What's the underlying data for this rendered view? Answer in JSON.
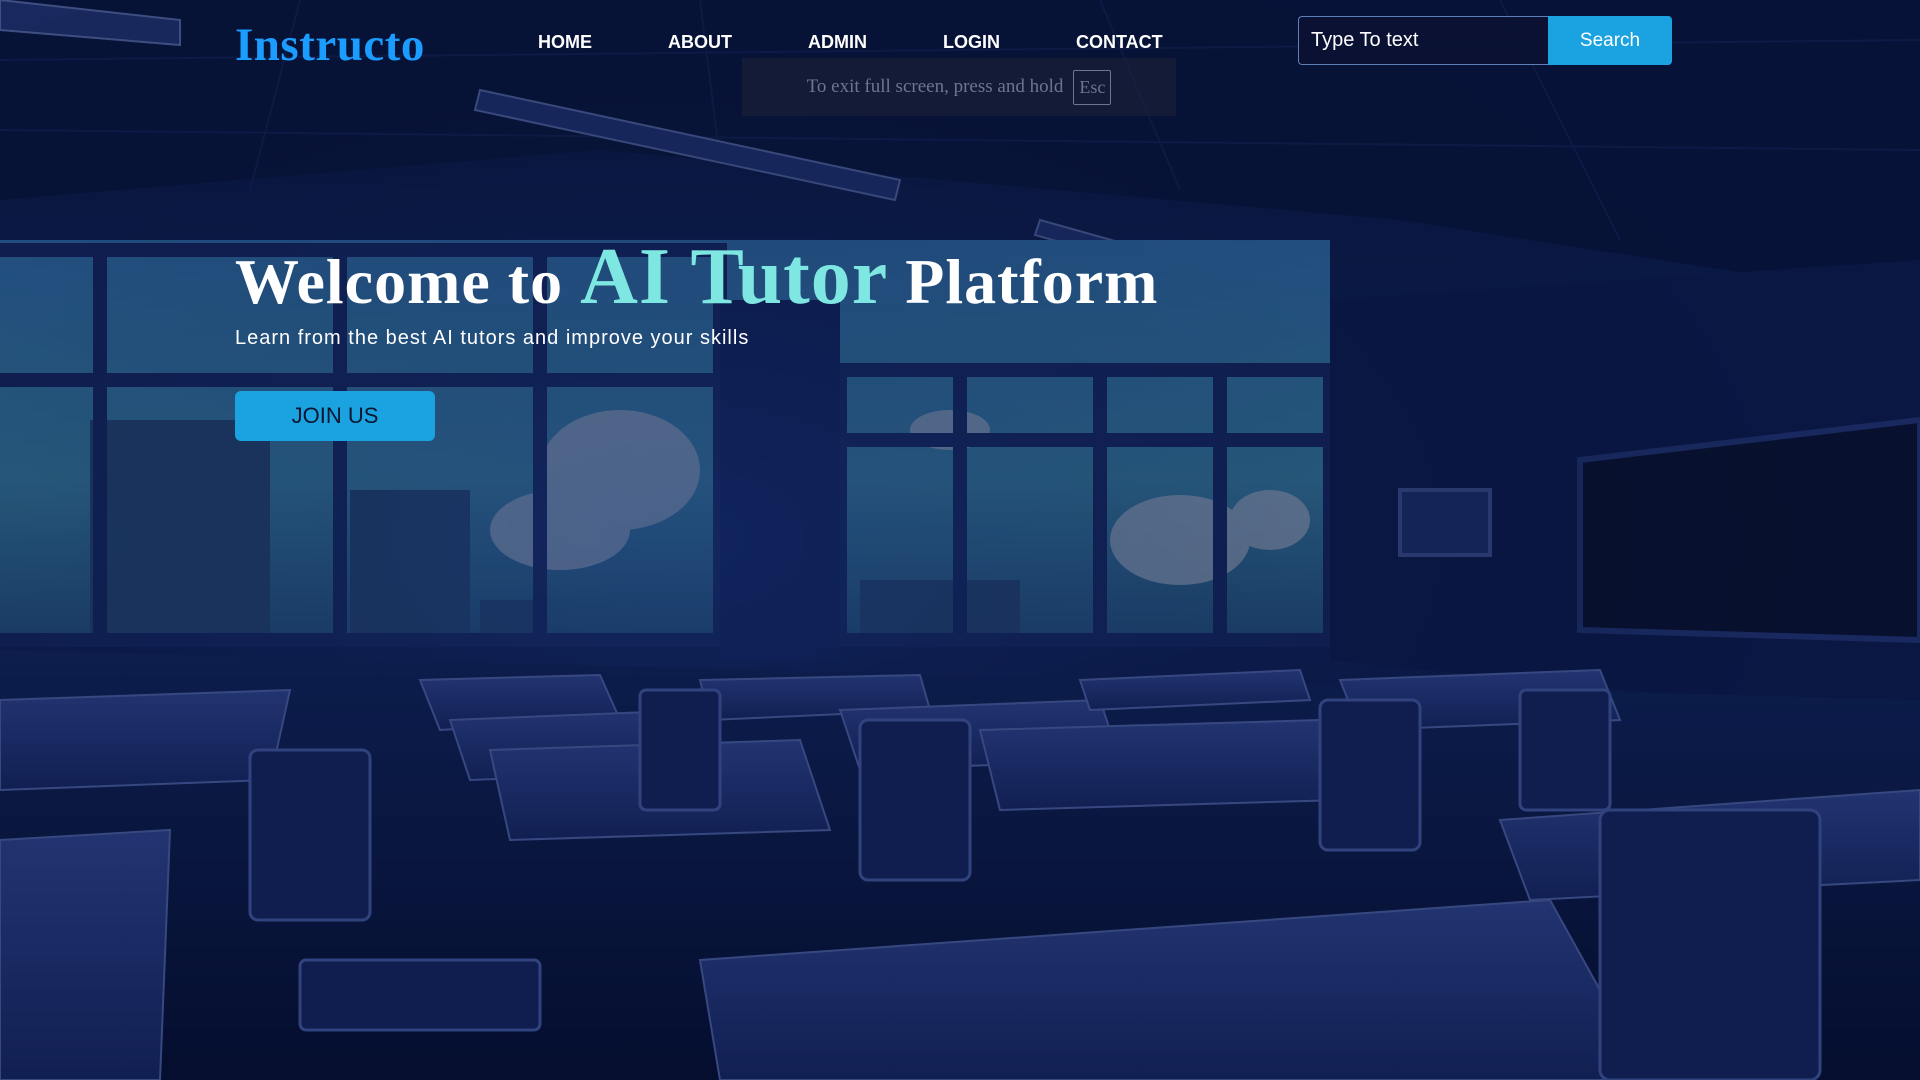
{
  "header": {
    "logo": "Instructo",
    "nav": [
      {
        "label": "HOME"
      },
      {
        "label": "ABOUT"
      },
      {
        "label": "ADMIN"
      },
      {
        "label": "LOGIN"
      },
      {
        "label": "CONTACT"
      }
    ],
    "search": {
      "placeholder": "Type To text",
      "button_label": "Search"
    }
  },
  "fullscreen_notice": {
    "text": "To exit full screen, press and hold",
    "key": "Esc"
  },
  "hero": {
    "title_prefix": "Welcome to",
    "title_accent": "AI Tutor",
    "title_suffix": "Platform",
    "subtitle": "Learn from the best AI tutors and improve your skills",
    "cta_label": "JOIN US"
  },
  "colors": {
    "logo": "#1a9dff",
    "accent": "#7fe7e2",
    "button": "#1aa3e0",
    "overlay": "#0a1440"
  }
}
